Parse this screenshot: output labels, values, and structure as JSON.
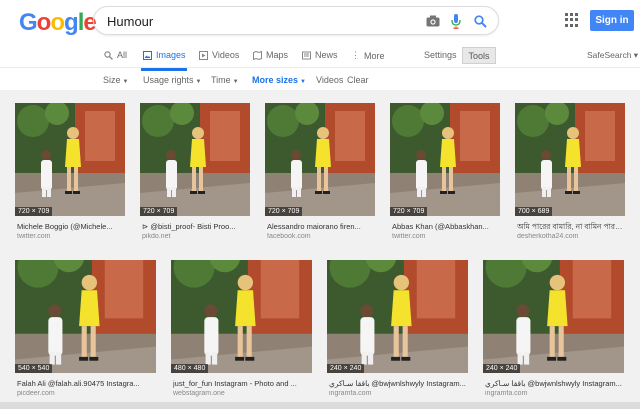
{
  "logo": {
    "letters": [
      {
        "ch": "G",
        "color": "#4285F4"
      },
      {
        "ch": "o",
        "color": "#EA4335"
      },
      {
        "ch": "o",
        "color": "#FBBC05"
      },
      {
        "ch": "g",
        "color": "#4285F4"
      },
      {
        "ch": "l",
        "color": "#34A853"
      },
      {
        "ch": "e",
        "color": "#EA4335"
      }
    ]
  },
  "search": {
    "value": "Humour"
  },
  "header": {
    "signin_label": "Sign in",
    "accent": "#4285f4"
  },
  "tabs": [
    {
      "label": "All",
      "icon": "search-icon"
    },
    {
      "label": "Images",
      "icon": "image-icon",
      "active": true
    },
    {
      "label": "Videos",
      "icon": "video-icon"
    },
    {
      "label": "Maps",
      "icon": "map-icon"
    },
    {
      "label": "News",
      "icon": "news-icon"
    },
    {
      "label": "More",
      "icon": "more-icon"
    }
  ],
  "tools": {
    "settings_label": "Settings",
    "tools_label": "Tools",
    "safesearch_label": "SafeSearch ▾"
  },
  "filters": [
    {
      "label": "Size"
    },
    {
      "label": "Usage rights"
    },
    {
      "label": "Time"
    },
    {
      "label": "More sizes"
    },
    {
      "label": "Videos"
    },
    {
      "label": "Clear"
    }
  ],
  "results": [
    {
      "dims": "720 × 709",
      "title": "Michele Boggio (@Michele...",
      "source": "twitter.com"
    },
    {
      "dims": "720 × 709",
      "title": "⊳ @bisti_proof- Bisti Proo...",
      "source": "pikdo.net"
    },
    {
      "dims": "720 × 709",
      "title": "Alessandro maiorano firen...",
      "source": "facebook.com"
    },
    {
      "dims": "720 × 709",
      "title": "Abbas Khan (@Abbaskhan...",
      "source": "twitter.com"
    },
    {
      "dims": "700 × 689",
      "title": "অমি পারের বামারি, না বামিন পারবা...",
      "source": "desherkotha24.com"
    },
    {
      "dims": "540 × 540",
      "title": "Falah Ali @falah.ali.90475 Instagra...",
      "source": "picdeer.com"
    },
    {
      "dims": "480 × 480",
      "title": "just_for_fun Instagram - Photo and ...",
      "source": "webstagram.one"
    },
    {
      "dims": "240 × 240",
      "title": "باققا سـاكري @bwjwnlshwyly Instagram...",
      "source": "ingramfa.com"
    },
    {
      "dims": "240 × 240",
      "title": "باققا سـاكري @bwjwnlshwyly Instagram...",
      "source": "ingramfa.com"
    }
  ]
}
